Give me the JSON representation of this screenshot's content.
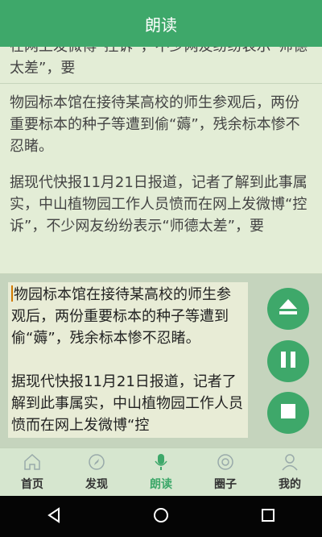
{
  "app_bar": {
    "title": "朗读"
  },
  "text_pane": {
    "top_fragment": "在网上发微博“控诉”，不少网友纷纷表示“师德太差”，要",
    "paragraph1": "物园标本馆在接待某高校的师生参观后，两份重要标本的种子等遭到偷“薅”，残余标本惨不忍睹。",
    "paragraph2": "据现代快报11月21日报道，记者了解到此事属实，中山植物园工作人员愤而在网上发微博“控诉”，不少网友纷纷表示“师德太差”，要"
  },
  "player": {
    "editor_text": "物园标本馆在接待某高校的师生参观后，两份重要标本的种子等遭到偷“薅”，残余标本惨不忍睹。\n\n据现代快报11月21日报道，记者了解到此事属实，中山植物园工作人员愤而在网上发微博“控",
    "controls": [
      "upload-icon",
      "pause-icon",
      "stop-icon"
    ]
  },
  "nav": {
    "items": [
      {
        "label": "首页",
        "icon": "home-icon"
      },
      {
        "label": "发现",
        "icon": "compass-icon"
      },
      {
        "label": "朗读",
        "icon": "microphone-icon",
        "active": true
      },
      {
        "label": "圈子",
        "icon": "circle-icon"
      },
      {
        "label": "我的",
        "icon": "user-icon"
      }
    ]
  },
  "colors": {
    "accent": "#3ea86a",
    "background": "#d9e8cf",
    "system_bar": "#050505"
  }
}
